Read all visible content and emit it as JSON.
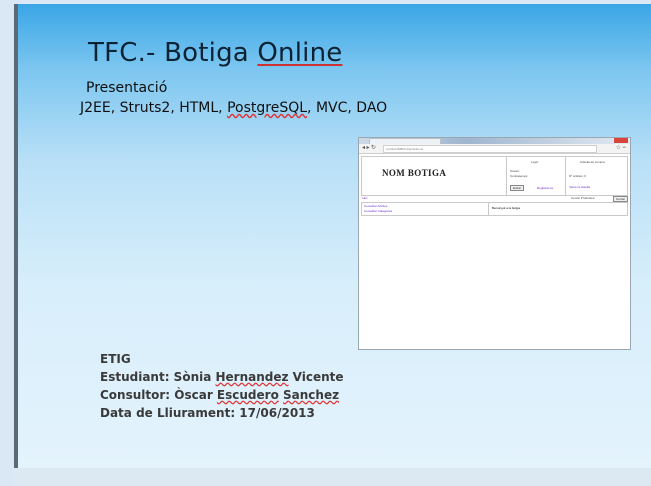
{
  "slide": {
    "title_prefix": "TFC.- Botiga ",
    "title_underlined": "Online",
    "subtitle": "Presentació",
    "tech_plain_1": "J2EE, Struts2, HTML, ",
    "tech_underlined": "PostgreSQL",
    "tech_plain_2": ", MVC, DAO",
    "info": {
      "etig": "ETIG",
      "student_label": "Estudiant: Sònia ",
      "student_u1": "Hernandez",
      "student_rest": " Vicente",
      "consultant_label": "Consultor: Òscar ",
      "consultant_u1": "Escudero",
      "consultant_sp": " ",
      "consultant_u2": "Sanchez",
      "delivery_label": "Data de Lliurament: 17/06/2013"
    }
  },
  "screenshot": {
    "url": "localhost:8080/botiga/index.do",
    "logo": "NOM BOTIGA",
    "login_title": "Login",
    "login_user": "Usuari:",
    "login_pass": "Contrasenya:",
    "login_enter": "Entrar",
    "login_register": "Registrar-se",
    "cart_title": "Cistella de compra",
    "cart_count": "Nº articles: 0",
    "cart_link": "Veure la cistella",
    "bar_left": "Inici",
    "bar_search": "Cercar Productes:",
    "bar_button": "Cercar",
    "col1_link1": "Consultar Articles",
    "col1_link2": "Consultar Categories",
    "col2_text": "Benvingut a la botiga"
  }
}
